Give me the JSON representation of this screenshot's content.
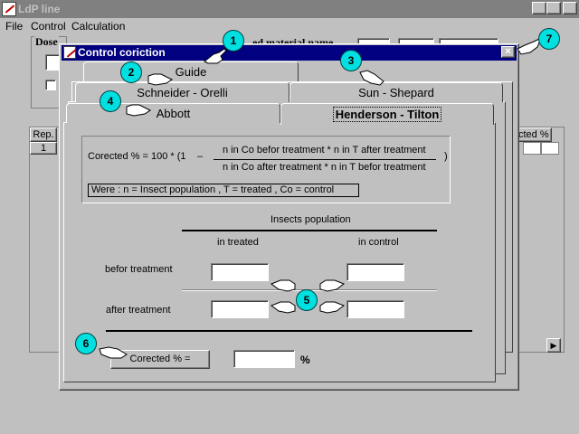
{
  "main_window": {
    "title": "LdP line",
    "menu": [
      "File",
      "Control",
      "Calculation"
    ],
    "dose_label": "Dose",
    "partial_title": "...ed material name",
    "table": {
      "col1_header": "Rep.",
      "row1": "1",
      "right_header": "cted %"
    }
  },
  "dialog": {
    "title": "Control coriction",
    "close_label": "×",
    "tabs": {
      "guide": "Guide",
      "schneider": "Schneider - Orelli",
      "sun": "Sun - Shepard",
      "abbott": "Abbott",
      "henderson": "Henderson - Tilton"
    },
    "formula": {
      "lead": "Corected % = 100 * (1",
      "minus": "–",
      "numerator": "n  in Co befor treatment *  n  in T  after treatment",
      "denominator": "n  in Co after treatment *  n  in T befor treatment",
      "close_paren": ")",
      "were": "Were :   n = Insect population ,     T = treated ,      Co = control"
    },
    "grid": {
      "title": "Insects population",
      "col_treated": "in treated",
      "col_control": "in control",
      "row_before": "befor treatment",
      "row_after": "after treatment",
      "values": {
        "before_treated": "",
        "before_control": "",
        "after_treated": "",
        "after_control": ""
      }
    },
    "result": {
      "button_label": "Corected % =",
      "value": "",
      "unit": "%"
    }
  },
  "callouts": [
    "1",
    "2",
    "3",
    "4",
    "5",
    "6",
    "7"
  ],
  "colors": {
    "dialog_title": "#000080",
    "main_title_inactive": "#808080",
    "face": "#c0c0c0",
    "callout": "#00e0e0"
  }
}
